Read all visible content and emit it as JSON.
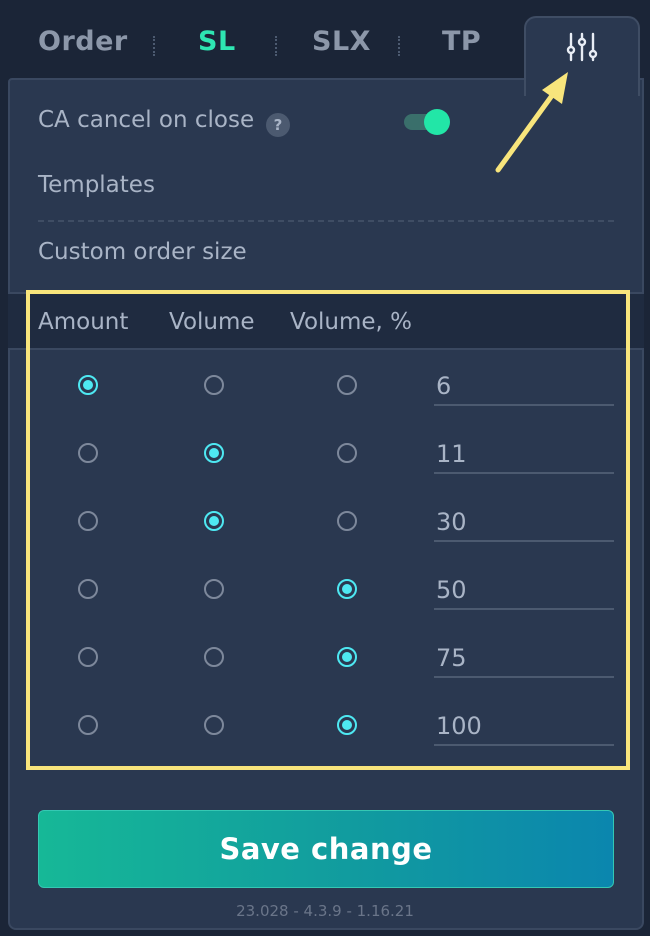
{
  "tabs": [
    {
      "label": "Order",
      "active": false
    },
    {
      "label": "SL",
      "active": true
    },
    {
      "label": "SLX",
      "active": false
    },
    {
      "label": "TP",
      "active": false
    }
  ],
  "settings_tab": {
    "icon": "sliders-icon",
    "active": true
  },
  "settings": {
    "ca_cancel_label": "CA cancel on close",
    "help_glyph": "?",
    "ca_cancel_enabled": true,
    "templates_label": "Templates",
    "custom_order_size_label": "Custom order size"
  },
  "table": {
    "columns": [
      "Amount",
      "Volume",
      "Volume, %"
    ],
    "rows": [
      {
        "selected": "Amount",
        "value": "6"
      },
      {
        "selected": "Volume",
        "value": "11"
      },
      {
        "selected": "Volume",
        "value": "30"
      },
      {
        "selected": "Volume, %",
        "value": "50"
      },
      {
        "selected": "Volume, %",
        "value": "75"
      },
      {
        "selected": "Volume, %",
        "value": "100"
      }
    ]
  },
  "save_button_label": "Save change",
  "version": "23.028 - 4.3.9 - 1.16.21",
  "colors": {
    "accent": "#2ee6b2",
    "radio_checked": "#4ee8f2",
    "highlight_box": "#f8e57c",
    "panel_bg": "#2a3850",
    "page_bg": "#1b2537"
  }
}
